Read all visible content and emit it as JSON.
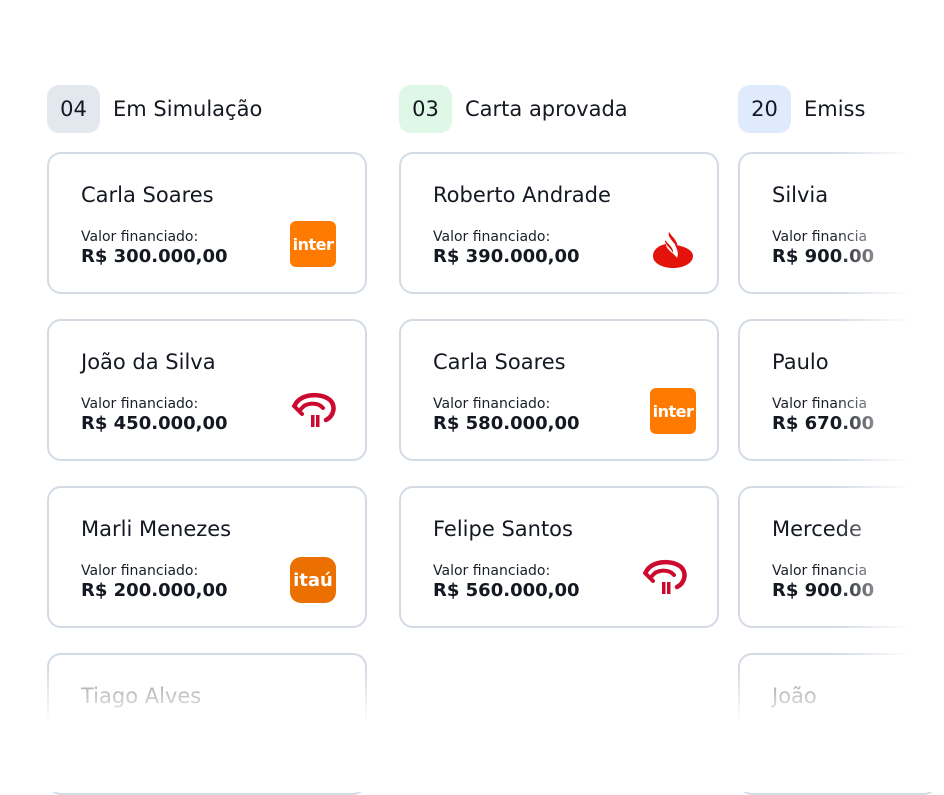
{
  "columns": [
    {
      "count": "04",
      "title": "Em Simulação",
      "badge_color": "#e3e8ef",
      "cards": [
        {
          "name": "Carla Soares",
          "label": "Valor financiado:",
          "value": "R$ 300.000,00",
          "bank": "inter",
          "bank_text": "inter"
        },
        {
          "name": "João da Silva",
          "label": "Valor financiado:",
          "value": "R$ 450.000,00",
          "bank": "bradesco"
        },
        {
          "name": "Marli Menezes",
          "label": "Valor financiado:",
          "value": "R$ 200.000,00",
          "bank": "itau",
          "bank_text": "itaú"
        },
        {
          "name": "Tiago Alves"
        }
      ]
    },
    {
      "count": "03",
      "title": "Carta aprovada",
      "badge_color": "#dff7e6",
      "cards": [
        {
          "name": "Roberto Andrade",
          "label": "Valor financiado:",
          "value": "R$ 390.000,00",
          "bank": "santander"
        },
        {
          "name": "Carla Soares",
          "label": "Valor financiado:",
          "value": "R$ 580.000,00",
          "bank": "inter",
          "bank_text": "inter"
        },
        {
          "name": "Felipe Santos",
          "label": "Valor financiado:",
          "value": "R$ 560.000,00",
          "bank": "bradesco"
        }
      ]
    },
    {
      "count": "20",
      "title": "Emiss",
      "badge_color": "#dfeafd",
      "cards": [
        {
          "name": "Silvia",
          "label": "Valor financia",
          "value": "R$ 900.00"
        },
        {
          "name": "Paulo",
          "label": "Valor financia",
          "value": "R$ 670.00"
        },
        {
          "name": "Mercede",
          "label": "Valor financia",
          "value": "R$ 900.00"
        },
        {
          "name": "João"
        }
      ]
    }
  ],
  "colors": {
    "card_border": "#d3dbe5",
    "inter_orange": "#ff7a00",
    "itau_orange": "#ec7000",
    "santander_red": "#e3120b",
    "bradesco_red": "#cc092f"
  }
}
